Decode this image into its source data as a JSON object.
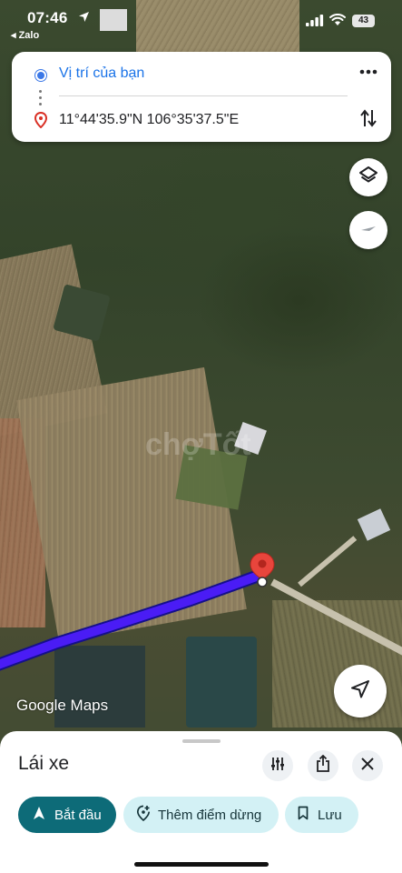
{
  "status_bar": {
    "time": "07:46",
    "back_app": "◂ Zalo",
    "battery": "43"
  },
  "route_card": {
    "origin": "Vị trí của bạn",
    "destination": "11°44'35.9\"N 106°35'37.5\"E"
  },
  "map": {
    "attribution": "Google Maps",
    "watermark": "chợTốt"
  },
  "bottom_sheet": {
    "title": "Lái xe",
    "start_label": "Bắt đầu",
    "add_stop_label": "Thêm điểm dừng",
    "save_label": "Lưu"
  },
  "colors": {
    "route": "#4a1cf5",
    "marker": "#e8453c",
    "start_chip": "#0d6b78",
    "secondary_chip": "#d3f1f5",
    "origin_text": "#1a73e8"
  },
  "icons": {
    "more": "more-vert-icon",
    "swap": "swap-vert-icon",
    "layers": "layers-icon",
    "compass": "compass-icon",
    "locate": "navigation-arrow-icon",
    "filter": "tune-icon",
    "share": "share-icon",
    "close": "close-icon",
    "start": "navigation-icon",
    "add_stop": "add-location-icon",
    "save": "bookmark-icon"
  }
}
